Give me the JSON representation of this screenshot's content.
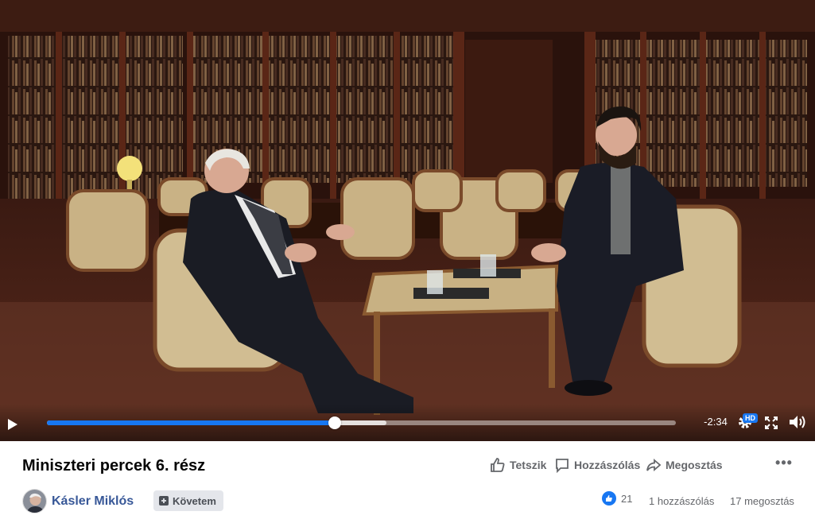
{
  "video": {
    "time_remaining": "-2:34",
    "progress_fraction": 0.458,
    "buffered_fraction": 0.54,
    "quality_badge": "HD"
  },
  "post": {
    "title": "Miniszteri percek 6. rész",
    "actions": {
      "like_label": "Tetszik",
      "comment_label": "Hozzászólás",
      "share_label": "Megosztás"
    },
    "author": "Kásler Miklós",
    "follow_label": "Követem",
    "reaction_count": "21",
    "comments_count": "1 hozzászólás",
    "shares_count": "17 megosztás"
  },
  "colors": {
    "accent": "#1877f2",
    "author_link": "#385898",
    "secondary_text": "#65676b"
  }
}
